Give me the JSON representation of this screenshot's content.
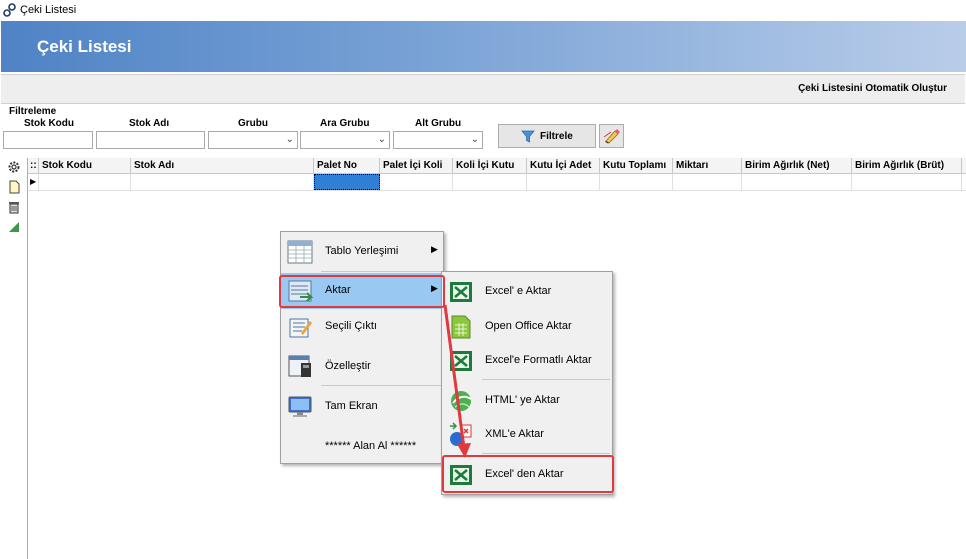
{
  "window": {
    "title": "Çeki Listesi"
  },
  "banner": {
    "title": "Çeki Listesi"
  },
  "toolbar": {
    "auto_create": "Çeki Listesini Otomatik Oluştur"
  },
  "filter": {
    "section_label": "Filtreleme",
    "stok_kodu": "Stok Kodu",
    "stok_adi": "Stok Adı",
    "grubu": "Grubu",
    "ara_grubu": "Ara Grubu",
    "alt_grubu": "Alt Grubu",
    "filter_button": "Filtrele"
  },
  "grid": {
    "columns": [
      "Stok Kodu",
      "Stok Adı",
      "Palet No",
      "Palet İçi Koli",
      "Koli İçi Kutu",
      "Kutu İçi Adet",
      "Kutu Toplamı",
      "Miktarı",
      "Birim Ağırlık (Net)",
      "Birim Ağırlık (Brüt)"
    ],
    "grip": "::",
    "row_indicator": "▶"
  },
  "context_menu": {
    "items": [
      {
        "label": "Tablo Yerleşimi",
        "icon": "table-layout-icon",
        "has_submenu": true
      },
      {
        "label": "Aktar",
        "icon": "export-icon",
        "has_submenu": true,
        "highlighted": true
      },
      {
        "label": "Seçili Çıktı",
        "icon": "print-selection-icon"
      },
      {
        "label": "Özelleştir",
        "icon": "customize-icon"
      },
      {
        "label": "Tam Ekran",
        "icon": "fullscreen-icon"
      },
      {
        "label": "****** Alan Al ******"
      }
    ]
  },
  "submenu": {
    "items": [
      {
        "label": "Excel' e Aktar",
        "icon": "excel-icon"
      },
      {
        "label": "Open Office Aktar",
        "icon": "open-office-icon"
      },
      {
        "label": "Excel'e Formatlı Aktar",
        "icon": "excel-icon"
      },
      {
        "label": "HTML' ye Aktar",
        "icon": "html-icon"
      },
      {
        "label": "XML'e Aktar",
        "icon": "xml-icon"
      },
      {
        "label": "Excel' den Aktar",
        "icon": "excel-icon",
        "annotated": true
      }
    ]
  },
  "colors": {
    "highlight": "#99c9f3",
    "annotation": "#e0393e",
    "banner_start": "#4f83c6"
  }
}
